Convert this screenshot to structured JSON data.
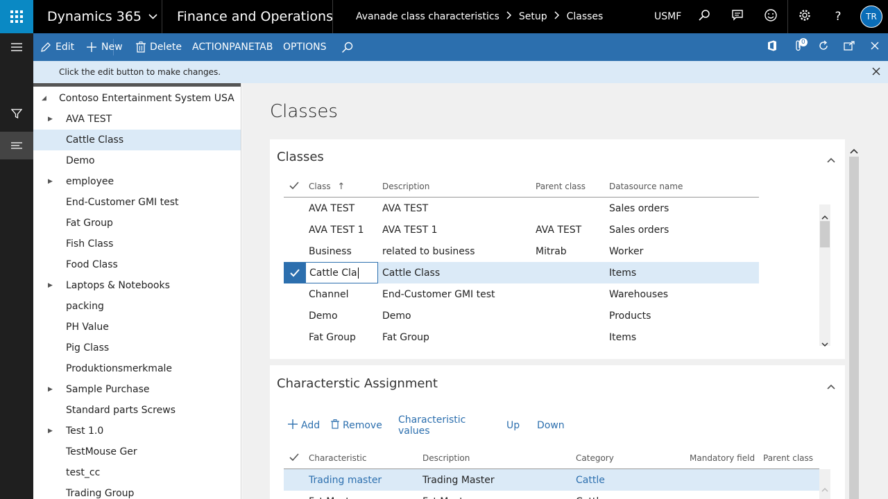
{
  "topbar": {
    "brand": "Dynamics 365",
    "module": "Finance and Operations",
    "breadcrumb": [
      "Avanade class characteristics",
      "Setup",
      "Classes"
    ],
    "company": "USMF",
    "user_initials": "TR"
  },
  "actionbar": {
    "edit": "Edit",
    "new": "New",
    "delete": "Delete",
    "actionpanetab": "ACTIONPANETAB",
    "options": "OPTIONS",
    "attachments_count": "0"
  },
  "message": "Click the edit button to make changes.",
  "tree": {
    "root": "Contoso Entertainment System USA",
    "items": [
      {
        "label": "AVA TEST",
        "expandable": true
      },
      {
        "label": "Cattle Class",
        "expandable": false
      },
      {
        "label": "Demo",
        "expandable": false
      },
      {
        "label": "employee",
        "expandable": true
      },
      {
        "label": "End-Customer GMI test",
        "expandable": false
      },
      {
        "label": "Fat Group",
        "expandable": false
      },
      {
        "label": "Fish Class",
        "expandable": false
      },
      {
        "label": "Food Class",
        "expandable": false
      },
      {
        "label": "Laptops & Notebooks",
        "expandable": true
      },
      {
        "label": "packing",
        "expandable": false
      },
      {
        "label": "PH Value",
        "expandable": false
      },
      {
        "label": "Pig Class",
        "expandable": false
      },
      {
        "label": "Produktionsmerkmale",
        "expandable": false
      },
      {
        "label": "Sample Purchase",
        "expandable": true
      },
      {
        "label": "Standard parts Screws",
        "expandable": false
      },
      {
        "label": "Test 1.0",
        "expandable": true
      },
      {
        "label": "TestMouse Ger",
        "expandable": false
      },
      {
        "label": "test_cc",
        "expandable": false
      },
      {
        "label": "Trading Group",
        "expandable": false
      }
    ],
    "selected_index": 1
  },
  "page_title": "Classes",
  "classes": {
    "title": "Classes",
    "columns": [
      "Class",
      "Description",
      "Parent class",
      "Datasource name"
    ],
    "sort_indicator": "↑",
    "rows": [
      {
        "class": "AVA TEST",
        "description": "AVA TEST",
        "parent": "",
        "datasource": "Sales orders"
      },
      {
        "class": "AVA TEST 1",
        "description": "AVA TEST 1",
        "parent": "AVA TEST",
        "datasource": "Sales orders"
      },
      {
        "class": "Business",
        "description": "related to business",
        "parent": "Mitrab",
        "datasource": "Worker"
      },
      {
        "class": "Cattle Cla",
        "description": "Cattle Class",
        "parent": "",
        "datasource": "Items"
      },
      {
        "class": "Channel",
        "description": "End-Customer GMI test",
        "parent": "",
        "datasource": "Warehouses"
      },
      {
        "class": "Demo",
        "description": "Demo",
        "parent": "",
        "datasource": "Products"
      },
      {
        "class": "Fat Group",
        "description": "Fat Group",
        "parent": "",
        "datasource": "Items"
      }
    ],
    "selected_index": 3
  },
  "characteristics": {
    "title": "Characterstic Assignment",
    "toolbar": {
      "add": "Add",
      "remove": "Remove",
      "values": "Characteristic values",
      "up": "Up",
      "down": "Down"
    },
    "columns": [
      "Characteristic",
      "Description",
      "Category",
      "Mandatory field",
      "Parent class"
    ],
    "rows": [
      {
        "characteristic": "Trading master",
        "description": "Trading Master",
        "category": "Cattle"
      },
      {
        "characteristic": "Fat Master",
        "description": "Fat Master",
        "category": "Cattle"
      }
    ],
    "selected_index": 0
  },
  "colors": {
    "accent": "#2c6fae",
    "waffle": "#0a89c4",
    "selection": "#dbeaf7"
  }
}
